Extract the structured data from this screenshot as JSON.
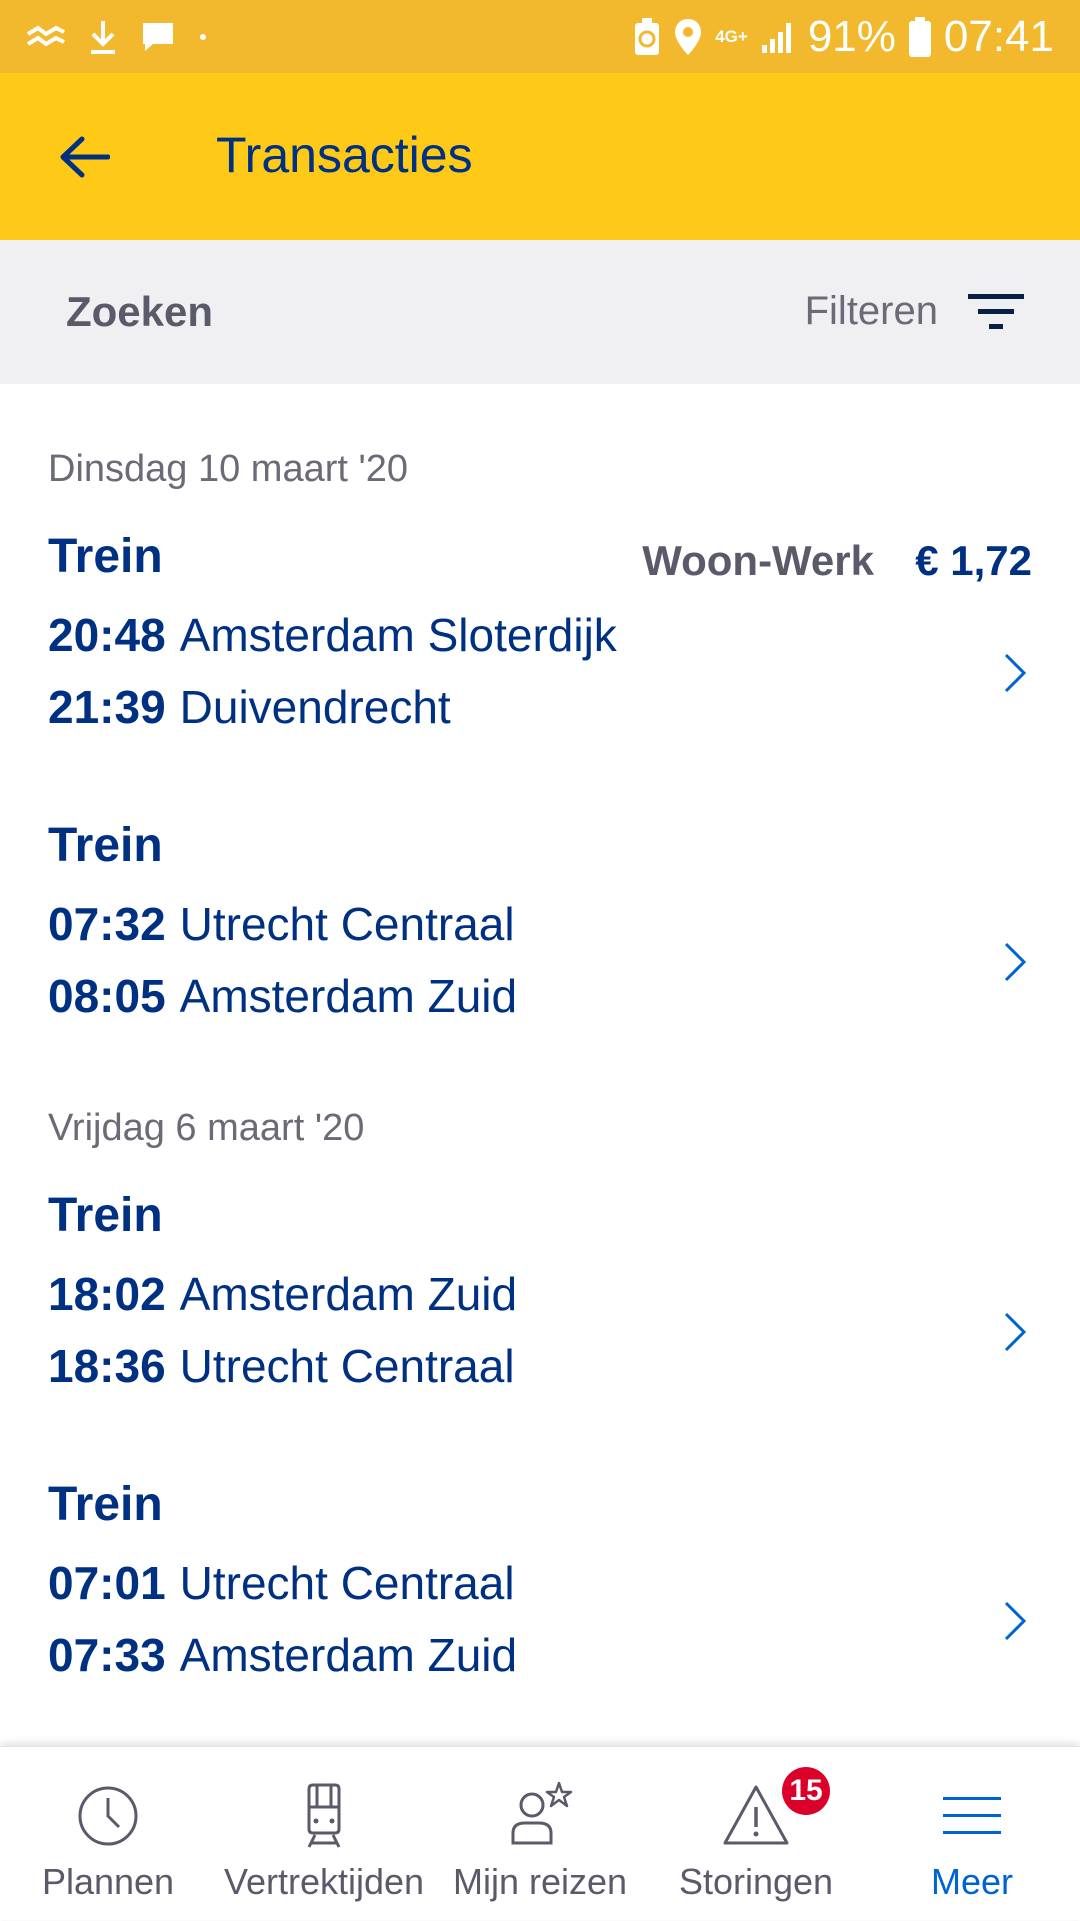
{
  "status_bar": {
    "network": "4G+",
    "battery": "91%",
    "time": "07:41",
    "icons": [
      "sync-icon",
      "download-icon",
      "message-icon",
      "dot-icon",
      "battery-saver-icon",
      "location-icon",
      "signal-icon",
      "battery-icon"
    ]
  },
  "app_bar": {
    "title": "Transacties",
    "back_icon": "arrow-left-icon"
  },
  "search": {
    "label": "Zoeken",
    "filter_label": "Filteren",
    "filter_icon": "filter-icon"
  },
  "groups": [
    {
      "date": "Dinsdag 10 maart '20",
      "trips": [
        {
          "type": "Trein",
          "category": "Woon-Werk",
          "price": "€ 1,72",
          "from_time": "20:48",
          "from": "Amsterdam Sloterdijk",
          "to_time": "21:39",
          "to": "Duivendrecht"
        },
        {
          "type": "Trein",
          "category": "",
          "price": "",
          "from_time": "07:32",
          "from": "Utrecht Centraal",
          "to_time": "08:05",
          "to": "Amsterdam Zuid"
        }
      ]
    },
    {
      "date": "Vrijdag 6 maart '20",
      "trips": [
        {
          "type": "Trein",
          "category": "",
          "price": "",
          "from_time": "18:02",
          "from": "Amsterdam Zuid",
          "to_time": "18:36",
          "to": "Utrecht Centraal"
        },
        {
          "type": "Trein",
          "category": "",
          "price": "",
          "from_time": "07:01",
          "from": "Utrecht Centraal",
          "to_time": "07:33",
          "to": "Amsterdam Zuid"
        }
      ]
    }
  ],
  "bottom_nav": {
    "items": [
      {
        "label": "Plannen",
        "icon": "clock-icon"
      },
      {
        "label": "Vertrektijden",
        "icon": "train-icon"
      },
      {
        "label": "Mijn reizen",
        "icon": "user-star-icon"
      },
      {
        "label": "Storingen",
        "icon": "warning-icon",
        "badge": "15"
      },
      {
        "label": "Meer",
        "icon": "menu-icon",
        "active": true
      }
    ]
  },
  "colors": {
    "status_bar": "#f2b92e",
    "app_bar": "#ffc917",
    "primary_text": "#003082",
    "active_nav": "#0063d3",
    "badge": "#db0029"
  }
}
